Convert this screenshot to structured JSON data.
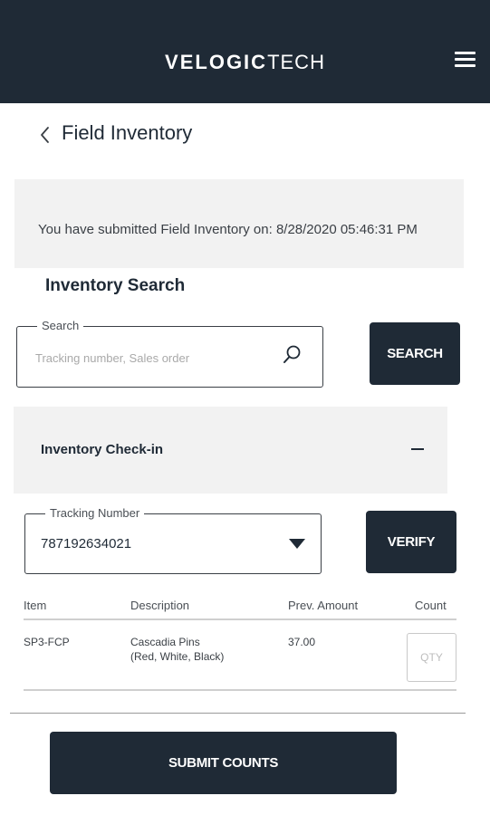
{
  "header": {
    "brand_bold": "VELOGIC",
    "brand_light": "TECH",
    "menu_icon": "hamburger-menu-icon",
    "background": "#1f2a36"
  },
  "page": {
    "back_icon": "chevron-left-icon",
    "title": "Field Inventory"
  },
  "notice": {
    "text": "You have submitted Field Inventory on: 8/28/2020 05:46:31 PM"
  },
  "inventory_search": {
    "title": "Inventory Search",
    "search_label": "Search",
    "search_placeholder": "Tracking number, Sales order",
    "search_value": "",
    "search_icon": "magnifier-icon",
    "search_button": "SEARCH"
  },
  "check_in": {
    "title": "Inventory Check-in",
    "collapse_icon": "minus-icon",
    "tracking_label": "Tracking Number",
    "tracking_value": "787192634021",
    "dropdown_icon": "triangle-down-icon",
    "verify_button": "VERIFY"
  },
  "table": {
    "columns": [
      "Item",
      "Description",
      "Prev. Amount",
      "Count"
    ],
    "rows": [
      {
        "item": "SP3-FCP",
        "description_line1": "Cascadia Pins",
        "description_line2": "(Red, White, Black)",
        "prev_amount": "37.00",
        "count_placeholder": "QTY",
        "count_value": ""
      }
    ]
  },
  "footer": {
    "submit_button": "SUBMIT COUNTS"
  },
  "colors": {
    "primary_dark": "#1f2a36",
    "panel_gray": "#f2f2f2",
    "white": "#ffffff"
  }
}
